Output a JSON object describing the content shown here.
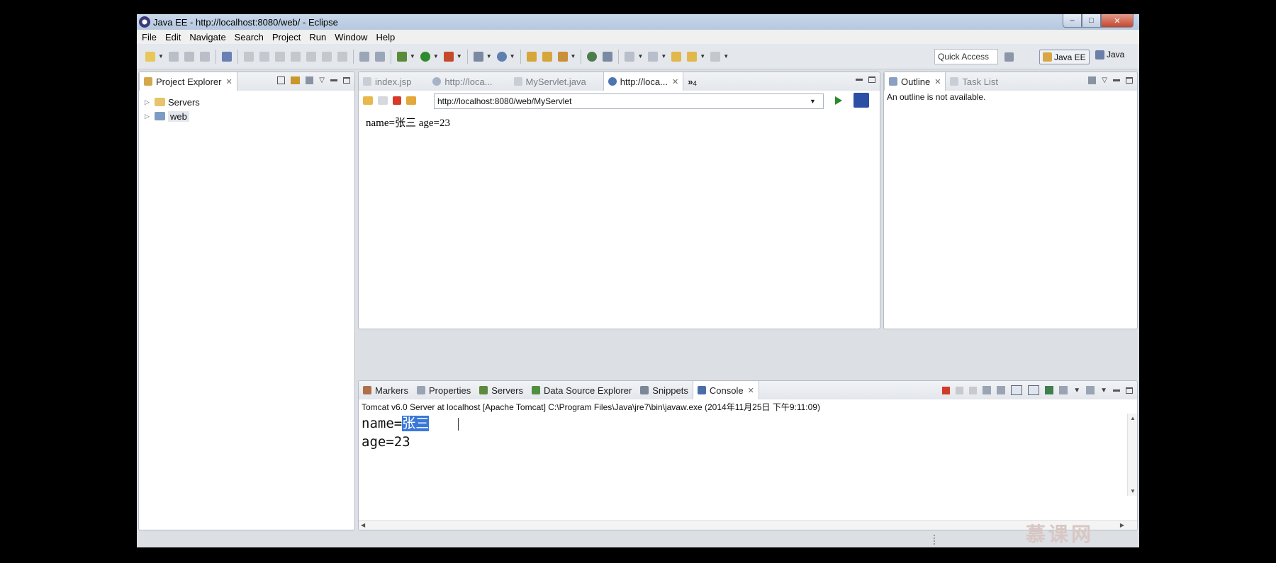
{
  "window": {
    "title": "Java EE - http://localhost:8080/web/ - Eclipse",
    "controls": [
      "–",
      "□",
      "✕"
    ]
  },
  "menu": [
    "File",
    "Edit",
    "Navigate",
    "Search",
    "Project",
    "Run",
    "Window",
    "Help"
  ],
  "toolbar": {
    "quick_access": "Quick Access",
    "perspectives": [
      {
        "label": "Java EE",
        "active": true
      },
      {
        "label": "Java",
        "active": false
      }
    ]
  },
  "project_explorer": {
    "tab_label": "Project Explorer",
    "items": [
      {
        "label": "Servers"
      },
      {
        "label": "web"
      }
    ]
  },
  "editor": {
    "tabs": [
      {
        "label": "index.jsp"
      },
      {
        "label": "http://loca..."
      },
      {
        "label": "MyServlet.java"
      },
      {
        "label": "http://loca..."
      }
    ],
    "overflow_label": "»",
    "overflow_count": "4",
    "url": "http://localhost:8080/web/MyServlet",
    "page_text": "name=张三 age=23"
  },
  "outline": {
    "tabs": [
      {
        "label": "Outline"
      },
      {
        "label": "Task List"
      }
    ],
    "message": "An outline is not available."
  },
  "bottom_panel": {
    "tabs": [
      {
        "label": "Markers"
      },
      {
        "label": "Properties"
      },
      {
        "label": "Servers"
      },
      {
        "label": "Data Source Explorer"
      },
      {
        "label": "Snippets"
      },
      {
        "label": "Console"
      }
    ],
    "console_header": "Tomcat v6.0 Server at localhost [Apache Tomcat] C:\\Program Files\\Java\\jre7\\bin\\javaw.exe (2014年11月25日 下午9:11:09)",
    "line1_prefix": "name=",
    "line1_selected": "张三",
    "line2": "age=23"
  },
  "watermark": "慕课网"
}
